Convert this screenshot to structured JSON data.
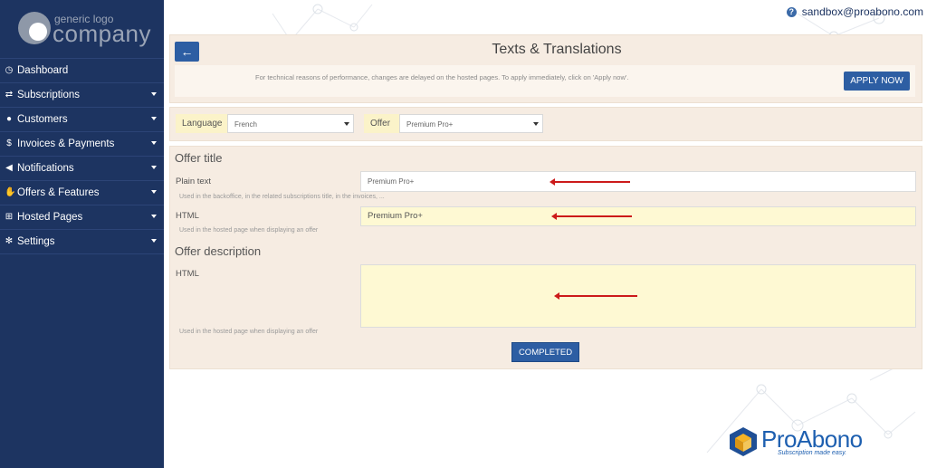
{
  "sidebar": {
    "logo": {
      "line1": "generic logo",
      "line2": "company"
    },
    "items": [
      {
        "label": "Dashboard",
        "icon": "dashboard-icon",
        "glyph": "◷",
        "has_caret": false
      },
      {
        "label": "Subscriptions",
        "icon": "retweet-icon",
        "glyph": "⇄",
        "has_caret": true
      },
      {
        "label": "Customers",
        "icon": "user-icon",
        "glyph": "●",
        "has_caret": true
      },
      {
        "label": "Invoices & Payments",
        "icon": "dollar-icon",
        "glyph": "$",
        "has_caret": true
      },
      {
        "label": "Notifications",
        "icon": "bullhorn-icon",
        "glyph": "◀",
        "has_caret": true
      },
      {
        "label": "Offers & Features",
        "icon": "thumbs-up-icon",
        "glyph": "✋",
        "has_caret": true
      },
      {
        "label": "Hosted Pages",
        "icon": "cart-icon",
        "glyph": "⊞",
        "has_caret": true
      },
      {
        "label": "Settings",
        "icon": "gear-icon",
        "glyph": "✻",
        "has_caret": true
      }
    ]
  },
  "header": {
    "user_email": "sandbox@proabono.com"
  },
  "page": {
    "title": "Texts & Translations",
    "notice": "For technical reasons of performance, changes are delayed on the hosted pages. To apply immediately, click on 'Apply now'.",
    "apply_label": "APPLY NOW"
  },
  "filters": {
    "language_label": "Language",
    "language_value": "French",
    "offer_label": "Offer",
    "offer_value": "Premium Pro+"
  },
  "form": {
    "offer_title_heading": "Offer title",
    "plain_text_label": "Plain text",
    "plain_text_value": "Premium Pro+",
    "plain_text_help": "Used in the backoffice, in the related subscriptions title, in the invoices, ...",
    "html_label": "HTML",
    "html_value": "Premium Pro+",
    "html_help": "Used in the hosted page when displaying an offer",
    "offer_description_heading": "Offer description",
    "desc_html_label": "HTML",
    "desc_html_value": "",
    "desc_html_help": "Used in the hosted page when displaying an offer",
    "completed_label": "COMPLETED"
  },
  "brand": {
    "name": "ProAbono",
    "tagline": "Subscription made easy."
  },
  "colors": {
    "sidebar": "#1d3461",
    "primary_button": "#2d5ea3",
    "panel": "#f6ece2",
    "highlight_field": "#fef9d3",
    "annotation_arrow": "#cc1a1a"
  }
}
